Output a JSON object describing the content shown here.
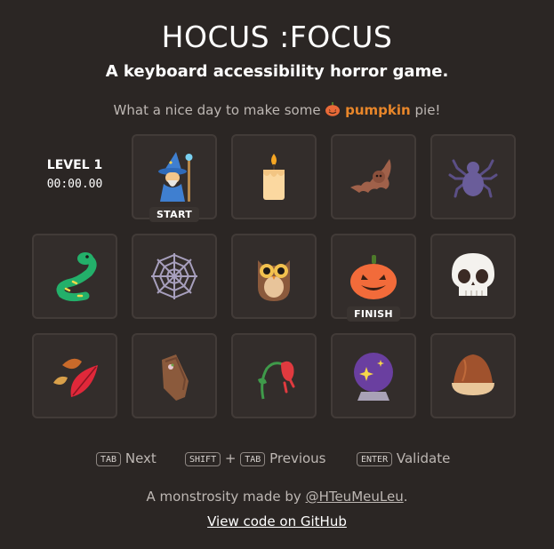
{
  "header": {
    "title": "HOCUS :FOCUS",
    "subtitle": "A keyboard accessibility horror game.",
    "prompt_before": "What a nice day to make some",
    "prompt_word": "pumpkin",
    "prompt_after": "pie!"
  },
  "status": {
    "level": "LEVEL 1",
    "timer": "00:00.00"
  },
  "board": {
    "start_label": "START",
    "finish_label": "FINISH",
    "cells": [
      {
        "name": "mage"
      },
      {
        "name": "candle"
      },
      {
        "name": "bat"
      },
      {
        "name": "spider"
      },
      {
        "name": "snake"
      },
      {
        "name": "spider-web"
      },
      {
        "name": "owl"
      },
      {
        "name": "jack-o-lantern"
      },
      {
        "name": "skull"
      },
      {
        "name": "fallen-leaves"
      },
      {
        "name": "coffin"
      },
      {
        "name": "wilted-flower"
      },
      {
        "name": "crystal-ball"
      },
      {
        "name": "chestnut"
      }
    ]
  },
  "controls": {
    "tab_key": "TAB",
    "next_label": "Next",
    "shift_key": "SHIFT",
    "plus": "+",
    "tab_key2": "TAB",
    "previous_label": "Previous",
    "enter_key": "ENTER",
    "validate_label": "Validate"
  },
  "footer": {
    "credit_before": "A monstrosity made by",
    "credit_link": "@HTeuMeuLeu",
    "credit_after": ".",
    "github_link": "View code on GitHub"
  }
}
